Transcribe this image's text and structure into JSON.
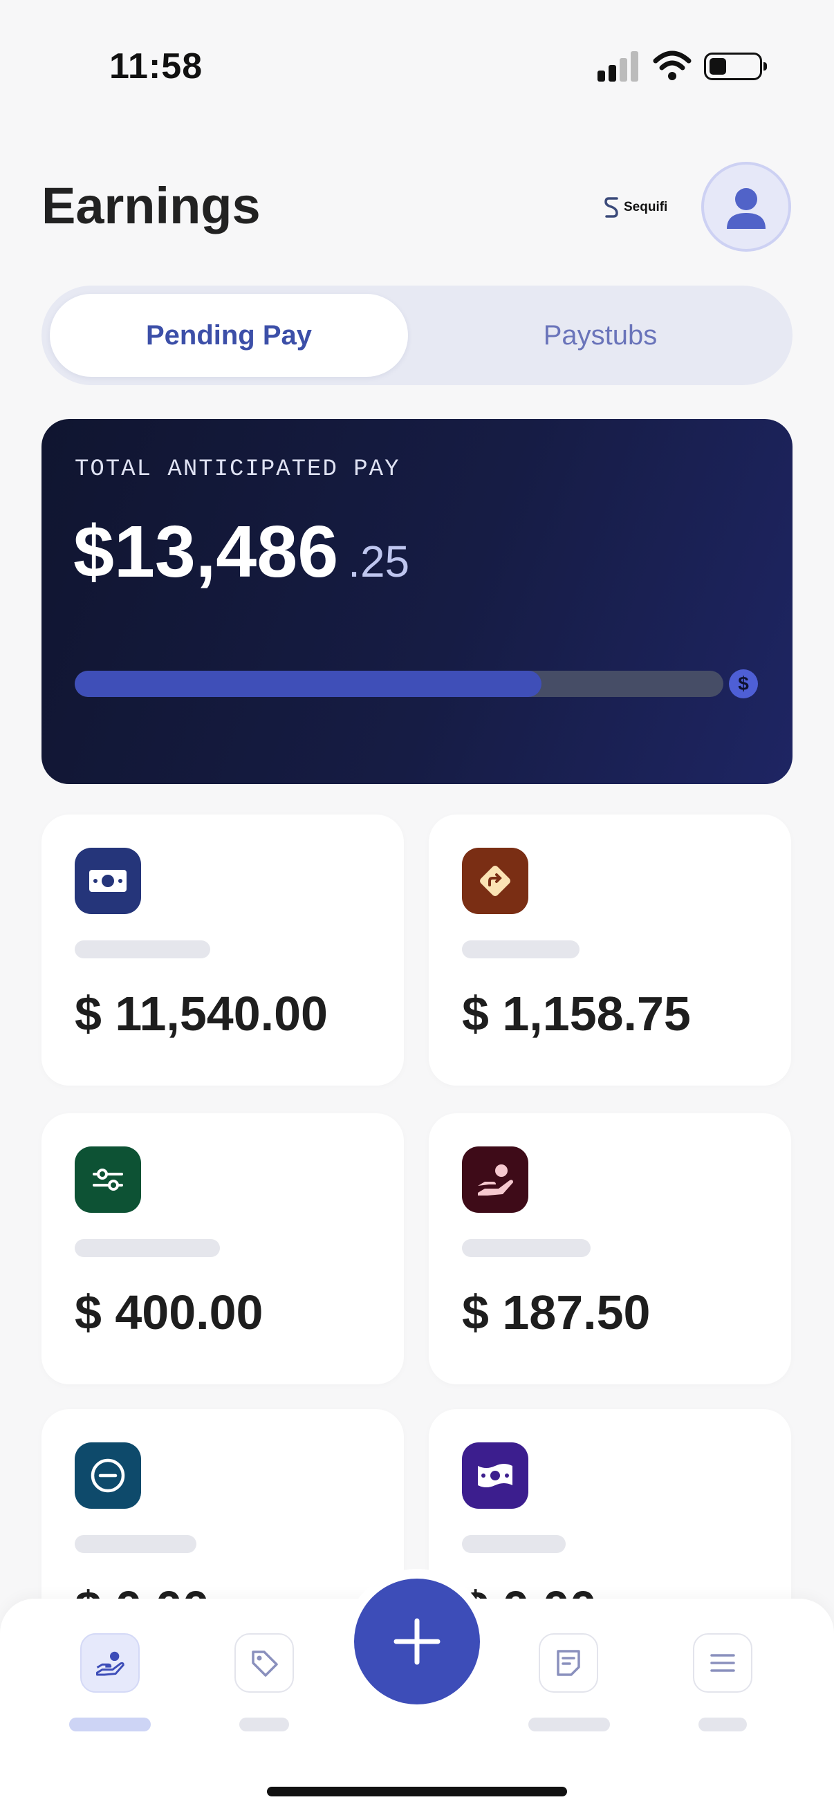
{
  "status_bar": {
    "time": "11:58"
  },
  "header": {
    "title": "Earnings",
    "brand_name": "Sequifi"
  },
  "tabs": [
    {
      "label": "Pending Pay",
      "active": true
    },
    {
      "label": "Paystubs",
      "active": false
    }
  ],
  "hero": {
    "label": "TOTAL ANTICIPATED PAY",
    "amount_main": "$13,486",
    "amount_cents": ".25",
    "progress_percent": 72,
    "progress_icon": "$"
  },
  "cards": [
    {
      "icon": "cash-icon",
      "color": "#25357a",
      "amount": "$ 11,540.00"
    },
    {
      "icon": "direction-sign-icon",
      "color": "#7a2e14",
      "amount": "$ 1,158.75"
    },
    {
      "icon": "sliders-icon",
      "color": "#0d5234",
      "amount": "$ 400.00"
    },
    {
      "icon": "hand-coin-icon",
      "color": "#3e0b18",
      "amount": "$ 187.50"
    },
    {
      "icon": "minus-circle-icon",
      "color": "#0e4a6b",
      "amount": "$ 0.00"
    },
    {
      "icon": "banknote-icon",
      "color": "#3c1e8e",
      "amount": "$ 0.00"
    }
  ],
  "bottom_nav": [
    {
      "icon": "hand-coin-icon",
      "active": true
    },
    {
      "icon": "tag-icon",
      "active": false
    },
    {
      "icon": "plus-icon",
      "active": false
    },
    {
      "icon": "document-icon",
      "active": false
    },
    {
      "icon": "menu-icon",
      "active": false
    }
  ],
  "colors": {
    "accent": "#3d4db8",
    "hero_bg": "#161c44"
  }
}
